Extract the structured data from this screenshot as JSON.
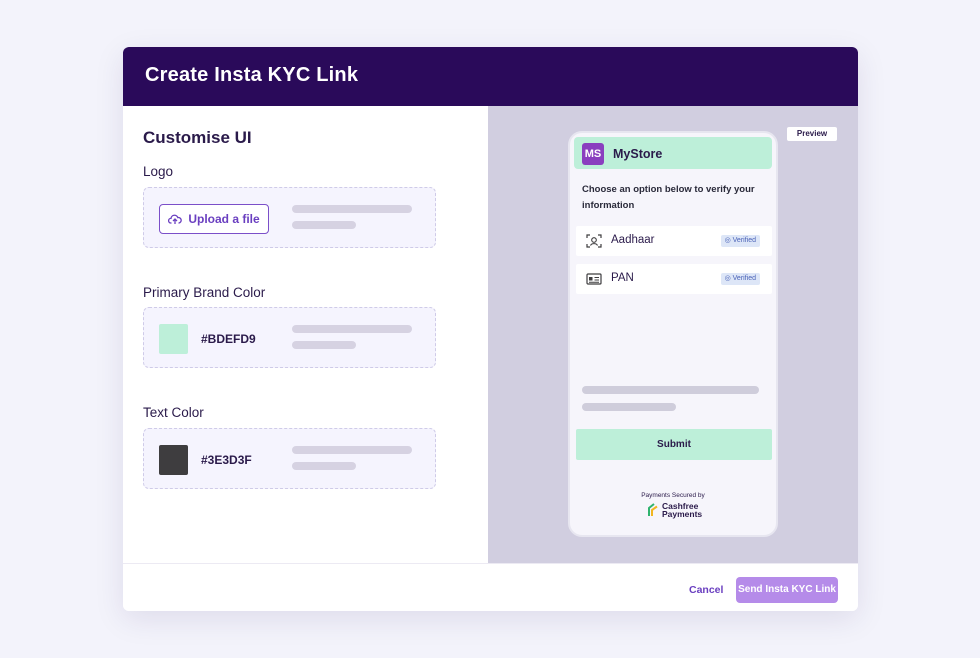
{
  "modal": {
    "title": "Create Insta KYC Link"
  },
  "customise": {
    "title": "Customise UI",
    "logo_label": "Logo",
    "upload_label": "Upload a file",
    "primary_label": "Primary Brand Color",
    "primary_hex": "#BDEFD9",
    "text_label": "Text Color",
    "text_hex": "#3E3D3F"
  },
  "preview": {
    "tag": "Preview",
    "store_initials": "MS",
    "store_name": "MyStore",
    "instruction": "Choose an option below to verify your information",
    "options": [
      {
        "label": "Aadhaar",
        "status": "Verified",
        "icon": "face-scan-icon"
      },
      {
        "label": "PAN",
        "status": "Verified",
        "icon": "id-card-icon"
      }
    ],
    "submit_label": "Submit",
    "secured_text": "Payments Secured by",
    "brand_line1": "Cashfree",
    "brand_line2": "Payments"
  },
  "footer": {
    "cancel_label": "Cancel",
    "send_label": "Send Insta KYC Link"
  },
  "colors": {
    "header": "#2a0a5a",
    "accent": "#6a3fc0",
    "primary_brand": "#BDEFD9",
    "text_color": "#3E3D3F",
    "send_button": "#b58be9"
  }
}
